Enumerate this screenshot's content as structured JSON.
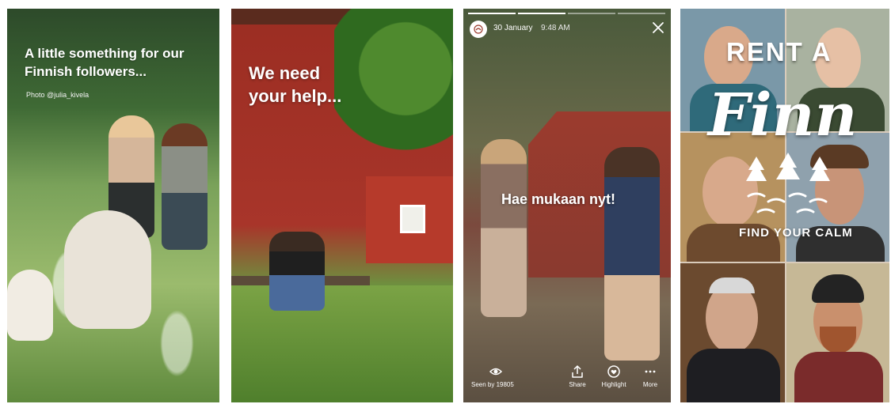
{
  "panel1": {
    "caption": "A little something for our Finnish followers...",
    "credit": "Photo @julia_kivela"
  },
  "panel2": {
    "caption_line1": "We need",
    "caption_line2": "your help..."
  },
  "panel3": {
    "date": "30 January",
    "time": "9:48 AM",
    "caption": "Hae mukaan nyt!",
    "seen_label": "Seen by 19805",
    "actions": [
      {
        "label": "Share",
        "icon": "share-icon"
      },
      {
        "label": "Highlight",
        "icon": "highlight-icon"
      },
      {
        "label": "More",
        "icon": "more-icon"
      }
    ],
    "progress_segments": 4,
    "progress_active": 2
  },
  "panel4": {
    "title_top": "RENT A",
    "title_main": "Finn",
    "tagline": "FIND YOUR CALM"
  },
  "colors": {
    "text": "#ffffff",
    "cabin_red": "#a8352a"
  }
}
